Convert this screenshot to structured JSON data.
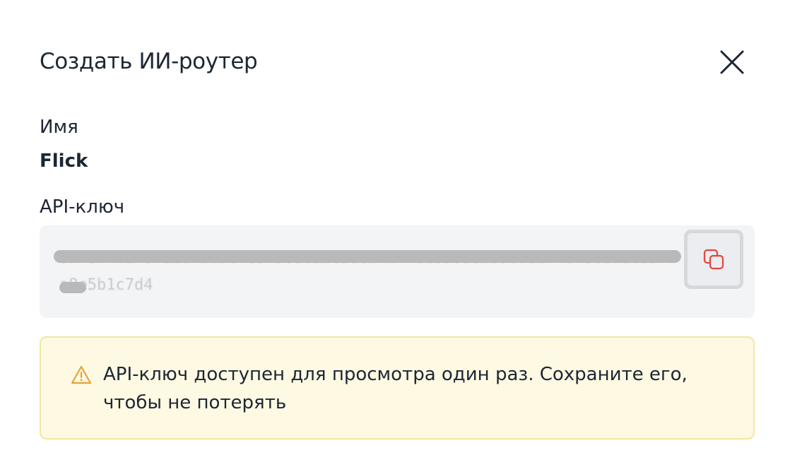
{
  "dialog": {
    "title": "Создать ИИ-роутер",
    "close_icon": "close-icon"
  },
  "name_field": {
    "label": "Имя",
    "value": "Flick"
  },
  "api_key_field": {
    "label": "API-ключ",
    "value": "sk-or-v1-8fd2c4a19b7e3f56d0a2c9e8b41f7d63a05e2b9c8d1f4a7e6b3c0d9f2a8e5b1c7d4",
    "copy_icon": "copy-icon",
    "copy_icon_color": "#e0473e"
  },
  "warning": {
    "icon": "warning-triangle-icon",
    "icon_color": "#e6a23c",
    "text": "API-ключ доступен для просмотра один раз. Сохраните его, чтобы не потерять"
  }
}
